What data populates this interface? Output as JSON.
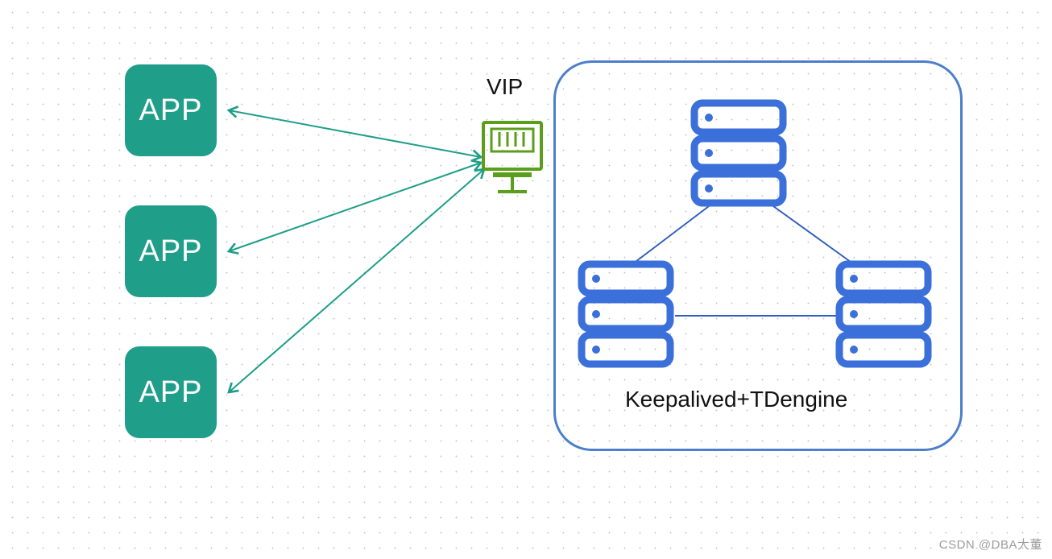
{
  "apps": [
    {
      "label": "APP"
    },
    {
      "label": "APP"
    },
    {
      "label": "APP"
    }
  ],
  "vip": {
    "label": "VIP"
  },
  "cluster": {
    "label": "Keepalived+TDengine",
    "nodes": [
      {
        "name": "server-top"
      },
      {
        "name": "server-left"
      },
      {
        "name": "server-right"
      }
    ]
  },
  "watermark": "CSDN @DBA大董",
  "colors": {
    "app_bg": "#1f9e89",
    "cluster_border": "#4b7ecb",
    "server": "#3b6fd9",
    "arrow": "#1f9e89",
    "link": "#2f5fbf",
    "vip_device": "#5a9e1b"
  }
}
